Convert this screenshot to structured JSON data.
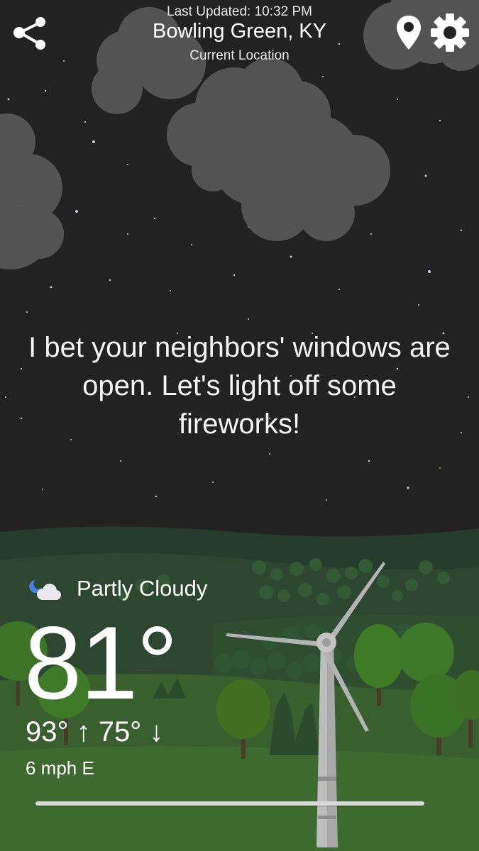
{
  "header": {
    "last_updated": "Last Updated: 10:32 PM",
    "city": "Bowling Green, KY",
    "location_label": "Current Location",
    "share_icon": "share-icon",
    "location_icon": "location-pin-icon",
    "settings_icon": "gear-icon"
  },
  "message": "I bet your neighbors' windows are open. Let's light off some fireworks!",
  "weather": {
    "condition_icon": "partly-cloudy-night-icon",
    "condition": "Partly Cloudy",
    "temperature": "81°",
    "high_low": "93° ↑ 75° ↓",
    "wind": "6 mph E"
  },
  "colors": {
    "sky": "#222223",
    "cloud": "#585858",
    "hills_far": "#2a4130",
    "hills_near": "#355f2c",
    "tree": "#3a6b27",
    "turbine": "#b0b0b0"
  }
}
